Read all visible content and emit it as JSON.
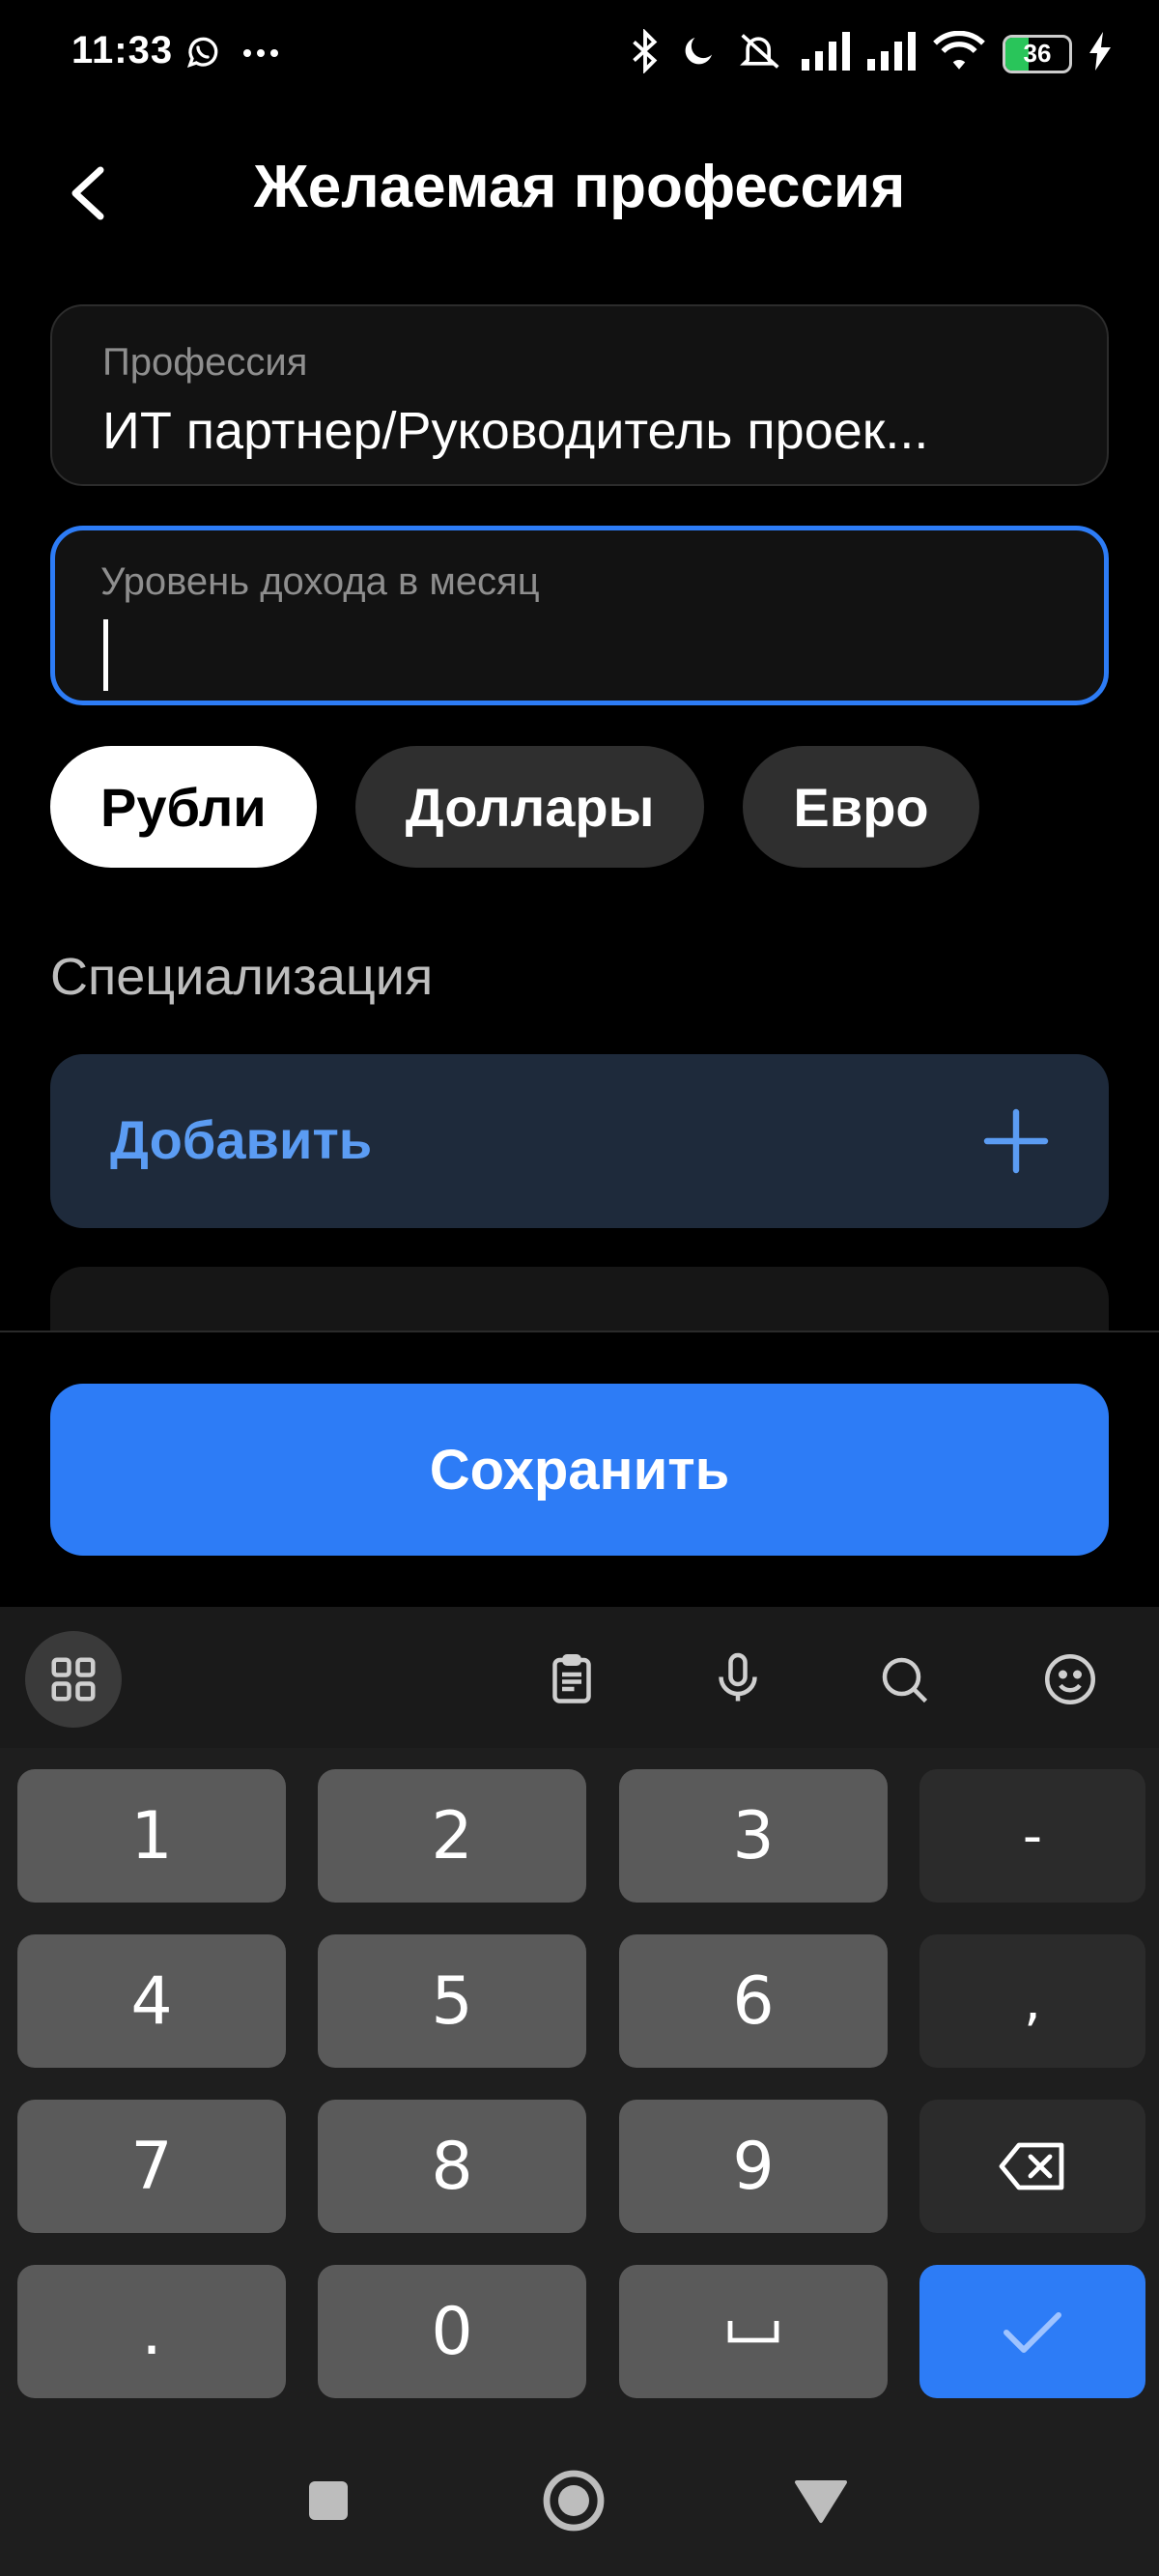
{
  "status_bar": {
    "time": "11:33",
    "battery_level": "36",
    "battery_percent": 36,
    "left_icons": [
      "whatsapp-icon",
      "more-dots-icon"
    ],
    "right_icons": [
      "bluetooth-icon",
      "moon-icon",
      "mute-icon",
      "signal-icon",
      "signal-icon",
      "wifi-icon",
      "battery-icon",
      "charging-icon"
    ]
  },
  "header": {
    "title": "Желаемая профессия",
    "back_icon": "chevron-left-icon"
  },
  "profession_field": {
    "label": "Профессия",
    "value": "ИТ партнер/Руководитель проек..."
  },
  "income_field": {
    "label": "Уровень дохода в месяц",
    "value": ""
  },
  "currencies": [
    {
      "label": "Рубли",
      "selected": true
    },
    {
      "label": "Доллары",
      "selected": false
    },
    {
      "label": "Евро",
      "selected": false
    }
  ],
  "specialization": {
    "title": "Специализация",
    "add_label": "Добавить",
    "add_icon": "plus-icon"
  },
  "save_button": {
    "label": "Сохранить"
  },
  "keyboard": {
    "toolbar": [
      "apps-grid-icon",
      "clipboard-icon",
      "microphone-icon",
      "search-icon",
      "emoji-icon"
    ],
    "rows": [
      [
        "1",
        "2",
        "3",
        "-"
      ],
      [
        "4",
        "5",
        "6",
        ","
      ],
      [
        "7",
        "8",
        "9",
        "backspace"
      ],
      [
        ".",
        "0",
        "space",
        "enter"
      ]
    ],
    "space_glyph": "␣"
  },
  "nav_bar": [
    "square-icon",
    "home-circle-icon",
    "back-triangle-icon"
  ],
  "colors": {
    "accent": "#2d7cf6",
    "add_text": "#5b9cf3",
    "add_bg": "#1e2a3b",
    "background": "#000000"
  }
}
